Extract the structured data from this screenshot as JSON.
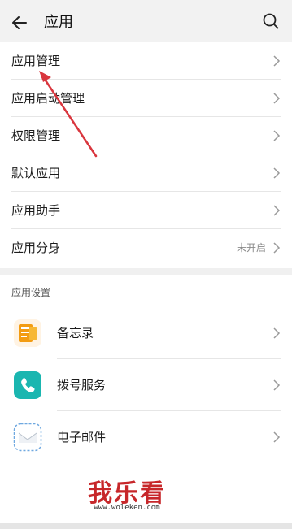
{
  "header": {
    "title": "应用"
  },
  "settings_list": {
    "items": [
      {
        "label": "应用管理",
        "value": ""
      },
      {
        "label": "应用启动管理",
        "value": ""
      },
      {
        "label": "权限管理",
        "value": ""
      },
      {
        "label": "默认应用",
        "value": ""
      },
      {
        "label": "应用助手",
        "value": ""
      },
      {
        "label": "应用分身",
        "value": "未开启"
      }
    ]
  },
  "app_settings": {
    "title": "应用设置",
    "items": [
      {
        "label": "备忘录",
        "icon": "notepad-icon"
      },
      {
        "label": "拨号服务",
        "icon": "phone-icon"
      },
      {
        "label": "电子邮件",
        "icon": "email-icon"
      }
    ]
  },
  "watermark": {
    "text": "我乐看",
    "url": "www.woleken.com"
  },
  "colors": {
    "annotation_arrow": "#d9363e",
    "phone_icon": "#1ab6b0",
    "notepad_icon": "#f39c12"
  }
}
